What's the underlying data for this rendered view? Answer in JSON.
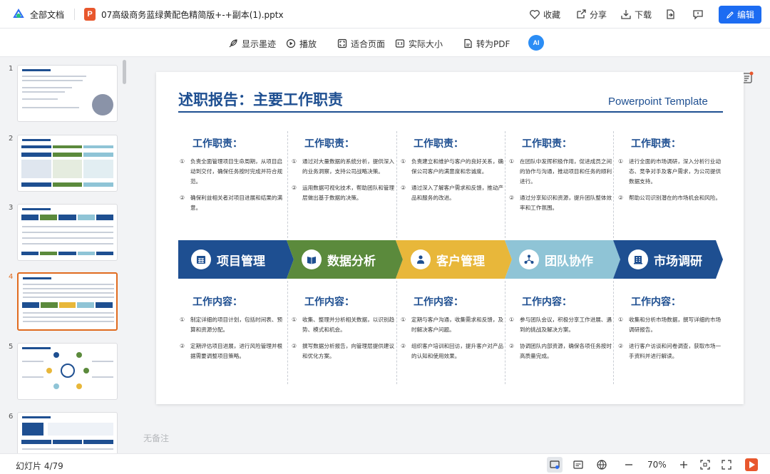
{
  "header": {
    "all_docs": "全部文档",
    "file_icon_letter": "P",
    "filename": "07高级商务蓝绿黄配色精简版+-+副本(1).pptx",
    "favorite": "收藏",
    "share": "分享",
    "download": "下载",
    "edit": "编辑"
  },
  "toolbar": {
    "show_ink": "显示墨迹",
    "play": "播放",
    "fit_page": "适合页面",
    "actual_size": "实际大小",
    "to_pdf": "转为PDF",
    "ai_label": "AI"
  },
  "thumbnails": [
    {
      "num": "1",
      "active": false
    },
    {
      "num": "2",
      "active": false
    },
    {
      "num": "3",
      "active": false
    },
    {
      "num": "4",
      "active": true
    },
    {
      "num": "5",
      "active": false
    },
    {
      "num": "6",
      "active": false
    }
  ],
  "slide": {
    "title": "述职报告：主要工作职责",
    "subtitle": "Powerpoint Template",
    "band_colors": [
      "#1e4f91",
      "#5b8a3c",
      "#e8b73a",
      "#8fc4d6",
      "#1e4f91"
    ],
    "columns": [
      {
        "category": "项目管理",
        "duty_head": "工作职责：",
        "duties": [
          {
            "n": "①",
            "t": "负责全面管理项目生命周期，从项目启动到交付，确保任务按时完成并符合规范。"
          },
          {
            "n": "②",
            "t": "确保利益相关者对项目进展和结果的满意。"
          }
        ],
        "content_head": "工作内容：",
        "contents": [
          {
            "n": "①",
            "t": "制定详细的项目计划，包括时间表、预算和资源分配。"
          },
          {
            "n": "②",
            "t": "定期评估项目进展，进行风险管理并根据需要调整项目策略。"
          }
        ]
      },
      {
        "category": "数据分析",
        "duty_head": "工作职责：",
        "duties": [
          {
            "n": "①",
            "t": "通过对大量数据的系统分析，提供深入的业务洞察，支持公司战略决策。"
          },
          {
            "n": "②",
            "t": "运用数据可视化技术，帮助团队和管理层做出基于数据的决策。"
          }
        ],
        "content_head": "工作内容：",
        "contents": [
          {
            "n": "①",
            "t": "收集、整理并分析相关数据，以识别趋势、模式和机会。"
          },
          {
            "n": "②",
            "t": "撰写数据分析报告，向管理层提供建议和优化方案。"
          }
        ]
      },
      {
        "category": "客户管理",
        "duty_head": "工作职责：",
        "duties": [
          {
            "n": "①",
            "t": "负责建立和维护与客户的良好关系，确保公司客户的满意度和忠诚度。"
          },
          {
            "n": "②",
            "t": "通过深入了解客户需求和反馈，推动产品和服务的改进。"
          }
        ],
        "content_head": "工作内容：",
        "contents": [
          {
            "n": "①",
            "t": "定期与客户沟通，收集需求和反馈，及时解决客户问题。"
          },
          {
            "n": "②",
            "t": "组织客户培训和回访，提升客户对产品的认知和使用效果。"
          }
        ]
      },
      {
        "category": "团队协作",
        "duty_head": "工作职责：",
        "duties": [
          {
            "n": "①",
            "t": "在团队中发挥积极作用，促进成员之间的协作与沟通，推动项目和任务的顺利进行。"
          },
          {
            "n": "②",
            "t": "通过分享知识和资源，提升团队整体效率和工作氛围。"
          }
        ],
        "content_head": "工作内容：",
        "contents": [
          {
            "n": "①",
            "t": "参与团队会议，积极分享工作进展、遇到的挑战及解决方案。"
          },
          {
            "n": "②",
            "t": "协调团队内部资源，确保各项任务按时高质量完成。"
          }
        ]
      },
      {
        "category": "市场调研",
        "duty_head": "工作职责：",
        "duties": [
          {
            "n": "①",
            "t": "进行全面的市场调研，深入分析行业动态、竞争对手及客户需求，为公司提供数据支持。"
          },
          {
            "n": "②",
            "t": "帮助公司识别潜在的市场机会和风险。"
          }
        ],
        "content_head": "工作内容：",
        "contents": [
          {
            "n": "①",
            "t": "收集和分析市场数据，撰写详细的市场调研报告。"
          },
          {
            "n": "②",
            "t": "进行客户访谈和问卷调查，获取市场一手资料并进行解读。"
          }
        ]
      }
    ]
  },
  "notes_placeholder": "无备注",
  "status": {
    "slide_count": "幻灯片 4/79",
    "zoom": "70%"
  }
}
